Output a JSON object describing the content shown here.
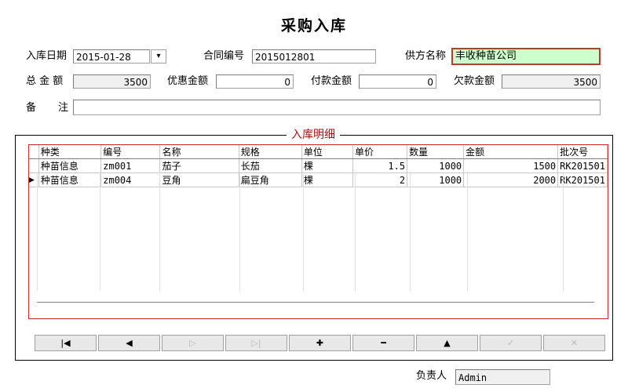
{
  "form": {
    "title": "采购入库",
    "labels": {
      "date": "入库日期",
      "contract": "合同编号",
      "supplier": "供方名称",
      "total": "总 金 额",
      "discount": "优惠金额",
      "paid": "付款金额",
      "owed": "欠款金额",
      "remark_a": "备",
      "remark_b": "注",
      "manager": "负责人"
    },
    "values": {
      "date": "2015-01-28",
      "contract": "2015012801",
      "supplier": "丰收种苗公司",
      "total": "3500",
      "discount": "0",
      "paid": "0",
      "owed": "3500",
      "remark": "",
      "manager": "Admin"
    },
    "date_dropdown_glyph": "▾"
  },
  "details": {
    "legend": "入库明细",
    "columns": [
      "种类",
      "编号",
      "名称",
      "规格",
      "单位",
      "单价",
      "数量",
      "金额",
      "批次号"
    ],
    "rows": [
      [
        "种苗信息",
        "zm001",
        "茄子",
        "长茄",
        "棵",
        "1.5",
        "1000",
        "1500",
        "RK201501"
      ],
      [
        "种苗信息",
        "zm004",
        "豆角",
        "扁豆角",
        "棵",
        "2",
        "1000",
        "2000",
        "RK201501"
      ]
    ],
    "current_row_indicator": "▶"
  },
  "navigator": {
    "buttons": [
      {
        "name": "first",
        "glyph": "|◀",
        "enabled": true
      },
      {
        "name": "prior",
        "glyph": "◀",
        "enabled": true
      },
      {
        "name": "next",
        "glyph": "▷",
        "enabled": false
      },
      {
        "name": "last",
        "glyph": "▷|",
        "enabled": false
      },
      {
        "name": "insert",
        "glyph": "✚",
        "enabled": true
      },
      {
        "name": "delete",
        "glyph": "━",
        "enabled": true
      },
      {
        "name": "edit",
        "glyph": "▲",
        "enabled": true
      },
      {
        "name": "post",
        "glyph": "✓",
        "enabled": false
      },
      {
        "name": "cancel",
        "glyph": "✕",
        "enabled": false
      }
    ]
  }
}
